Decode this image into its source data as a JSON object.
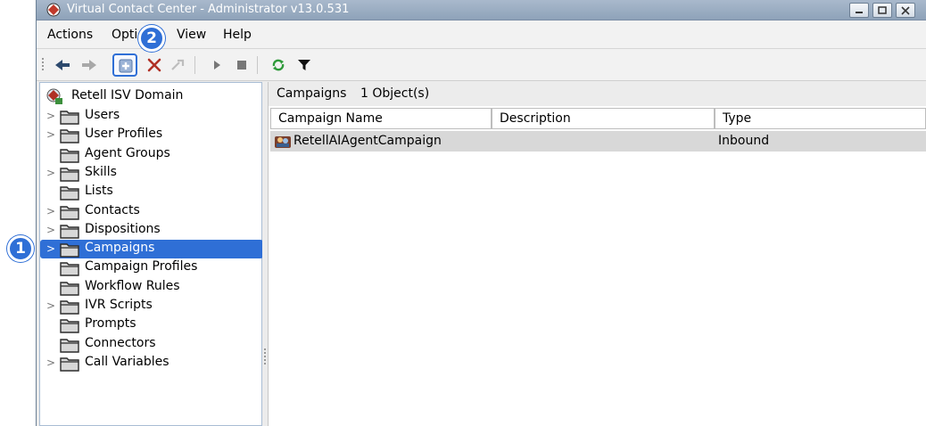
{
  "window": {
    "title": "Virtual Contact Center - Administrator v13.0.531"
  },
  "menu": [
    "Actions",
    "Options",
    "View",
    "Help"
  ],
  "menu_labels": {
    "actions": "Actions",
    "options": "Opti",
    "view": "View",
    "help": "Help"
  },
  "tree": {
    "root": "Retell ISV Domain",
    "items": [
      {
        "label": "Users",
        "expandable": true
      },
      {
        "label": "User Profiles",
        "expandable": true
      },
      {
        "label": "Agent Groups",
        "expandable": false
      },
      {
        "label": "Skills",
        "expandable": true
      },
      {
        "label": "Lists",
        "expandable": false
      },
      {
        "label": "Contacts",
        "expandable": true
      },
      {
        "label": "Dispositions",
        "expandable": true
      },
      {
        "label": "Campaigns",
        "expandable": true,
        "selected": true
      },
      {
        "label": "Campaign Profiles",
        "expandable": false
      },
      {
        "label": "Workflow Rules",
        "expandable": false
      },
      {
        "label": "IVR Scripts",
        "expandable": true
      },
      {
        "label": "Prompts",
        "expandable": false
      },
      {
        "label": "Connectors",
        "expandable": false
      },
      {
        "label": "Call Variables",
        "expandable": true
      }
    ]
  },
  "content": {
    "title": "Campaigns",
    "count": "1 Object(s)",
    "columns": [
      "Campaign Name",
      "Description",
      "Type"
    ],
    "rows": [
      {
        "name": "RetellAIAgentCampaign",
        "description": "",
        "type": "Inbound"
      }
    ]
  },
  "callouts": {
    "one": "1",
    "two": "2"
  },
  "colors": {
    "accent": "#2f6fd6",
    "titlebar": "#8ea2b9",
    "row_selected": "#d8d8d8"
  },
  "icons": [
    "app-icon",
    "back-arrow-icon",
    "forward-arrow-icon",
    "new-item-icon",
    "delete-icon",
    "properties-icon",
    "start-icon",
    "stop-icon",
    "refresh-icon",
    "filter-icon",
    "folder-icon",
    "domain-icon",
    "campaign-icon"
  ]
}
